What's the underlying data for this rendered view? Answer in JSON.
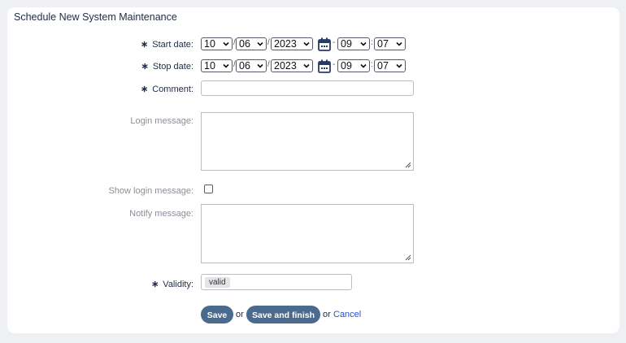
{
  "form_title": "Schedule New System Maintenance",
  "start_date": {
    "label": "Start date:",
    "month": "10",
    "day": "06",
    "year": "2023",
    "hour": "09",
    "minute": "07"
  },
  "stop_date": {
    "label": "Stop date:",
    "month": "10",
    "day": "06",
    "year": "2023",
    "hour": "09",
    "minute": "07"
  },
  "comment": {
    "label": "Comment:",
    "value": ""
  },
  "login_message": {
    "label": "Login message:",
    "value": ""
  },
  "show_login_message": {
    "label": "Show login message:",
    "checked": false
  },
  "notify_message": {
    "label": "Notify message:",
    "value": ""
  },
  "validity": {
    "label": "Validity:",
    "value": "valid"
  },
  "required_marker": "∗",
  "date_separator": "/",
  "time_separator": "-",
  "minute_separator": ":",
  "actions": {
    "save_label": "Save",
    "or_text_1": "or",
    "save_finish_label": "Save and finish",
    "or_text_2": "or",
    "cancel_label": "Cancel"
  },
  "colors": {
    "button_bg": "#4b6a8f",
    "link": "#2a4fc9",
    "muted_label": "#8a8f99"
  },
  "icons": [
    "calendar-icon",
    "chevron-down-icon",
    "resize-grip-icon"
  ]
}
